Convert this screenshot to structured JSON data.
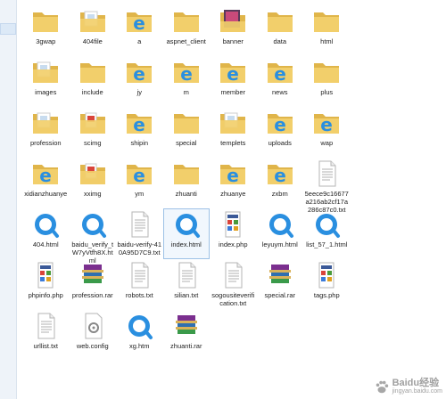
{
  "files": [
    {
      "label": "3gwap",
      "icon": "folder"
    },
    {
      "label": "404file",
      "icon": "folder-pages"
    },
    {
      "label": "a",
      "icon": "folder-ie"
    },
    {
      "label": "aspnet_client",
      "icon": "folder"
    },
    {
      "label": "banner",
      "icon": "folder-photo"
    },
    {
      "label": "data",
      "icon": "folder"
    },
    {
      "label": "html",
      "icon": "folder"
    },
    {
      "label": "images",
      "icon": "folder-pages"
    },
    {
      "label": "include",
      "icon": "folder"
    },
    {
      "label": "jy",
      "icon": "folder-ie"
    },
    {
      "label": "m",
      "icon": "folder-ie"
    },
    {
      "label": "member",
      "icon": "folder-ie"
    },
    {
      "label": "news",
      "icon": "folder-ie"
    },
    {
      "label": "plus",
      "icon": "folder"
    },
    {
      "label": "profession",
      "icon": "folder-pages"
    },
    {
      "label": "scimg",
      "icon": "folder-red"
    },
    {
      "label": "shipin",
      "icon": "folder-ie"
    },
    {
      "label": "special",
      "icon": "folder"
    },
    {
      "label": "templets",
      "icon": "folder-pages"
    },
    {
      "label": "uploads",
      "icon": "folder-ie"
    },
    {
      "label": "wap",
      "icon": "folder-ie"
    },
    {
      "label": "xidianzhuanye",
      "icon": "folder-ie"
    },
    {
      "label": "xximg",
      "icon": "folder-red"
    },
    {
      "label": "ym",
      "icon": "folder-ie"
    },
    {
      "label": "zhuanti",
      "icon": "folder"
    },
    {
      "label": "zhuanye",
      "icon": "folder-ie"
    },
    {
      "label": "zxbm",
      "icon": "folder-ie"
    },
    {
      "label": "5eece9c16677a216ab2cf17a286c87c0.txt",
      "icon": "text"
    },
    {
      "label": "404.html",
      "icon": "browser"
    },
    {
      "label": "baidu_verify_tW7yVtfh8X.html",
      "icon": "browser"
    },
    {
      "label": "baidu-verify-410A95D7C9.txt",
      "icon": "text"
    },
    {
      "label": "index.html",
      "icon": "browser",
      "selected": true
    },
    {
      "label": "index.php",
      "icon": "php"
    },
    {
      "label": "leyuym.html",
      "icon": "browser"
    },
    {
      "label": "list_57_1.html",
      "icon": "browser"
    },
    {
      "label": "phpinfo.php",
      "icon": "php"
    },
    {
      "label": "profession.rar",
      "icon": "rar"
    },
    {
      "label": "robots.txt",
      "icon": "text"
    },
    {
      "label": "silian.txt",
      "icon": "text"
    },
    {
      "label": "sogousiteverification.txt",
      "icon": "text"
    },
    {
      "label": "special.rar",
      "icon": "rar"
    },
    {
      "label": "tags.php",
      "icon": "php"
    },
    {
      "label": "urllist.txt",
      "icon": "text"
    },
    {
      "label": "web.config",
      "icon": "config"
    },
    {
      "label": "xg.htm",
      "icon": "browser"
    },
    {
      "label": "zhuanti.rar",
      "icon": "rar"
    }
  ],
  "colors": {
    "folder": "#f2cf6b",
    "folder_dark": "#e0b54a",
    "browser_blue": "#2a8fe0",
    "selection": "#9dc1e6"
  },
  "watermark": {
    "main": "Baidu经验",
    "sub": "jingyan.baidu.com"
  }
}
